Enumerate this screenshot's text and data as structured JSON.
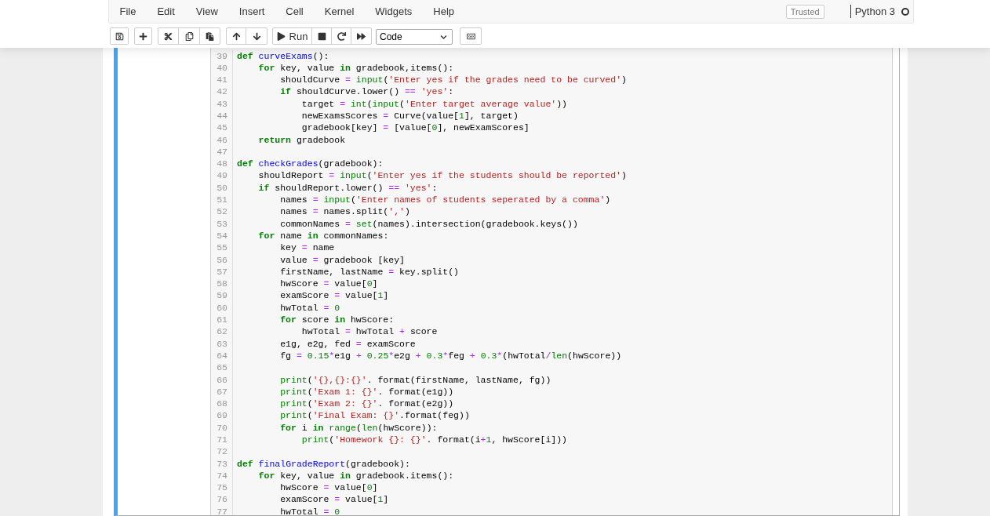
{
  "menu": [
    "File",
    "Edit",
    "View",
    "Insert",
    "Cell",
    "Kernel",
    "Widgets",
    "Help"
  ],
  "trust_indicator": "Trusted",
  "kernel": {
    "name": "Python 3",
    "busy": false
  },
  "toolbar": {
    "run_label": "Run",
    "cell_type": "Code"
  },
  "cell": {
    "selected": true,
    "lines": [
      {
        "number": "39",
        "tokens": [
          {
            "kind": "keyword",
            "text": "def"
          },
          {
            "kind": "name",
            "text": " curveExams"
          },
          {
            "kind": "plain",
            "text": "():"
          }
        ]
      },
      {
        "number": "40",
        "tokens": [
          {
            "kind": "keyword",
            "text": "    for"
          },
          {
            "kind": "plain",
            "text": " key, value "
          },
          {
            "kind": "keyword",
            "text": "in"
          },
          {
            "kind": "plain",
            "text": " gradebook,items():"
          }
        ]
      },
      {
        "number": "41",
        "tokens": [
          {
            "kind": "plain",
            "text": "        shouldCurve "
          },
          {
            "kind": "operator",
            "text": "="
          },
          {
            "kind": "builtin",
            "text": " input"
          },
          {
            "kind": "plain",
            "text": "("
          },
          {
            "kind": "string",
            "text": "'Enter yes if the grades need to be curved'"
          },
          {
            "kind": "plain",
            "text": ")"
          }
        ]
      },
      {
        "number": "42",
        "tokens": [
          {
            "kind": "keyword",
            "text": "        if"
          },
          {
            "kind": "plain",
            "text": " shouldCurve.lower() "
          },
          {
            "kind": "operator",
            "text": "=="
          },
          {
            "kind": "string",
            "text": " 'yes'"
          },
          {
            "kind": "plain",
            "text": ":"
          }
        ]
      },
      {
        "number": "43",
        "tokens": [
          {
            "kind": "plain",
            "text": "            target "
          },
          {
            "kind": "operator",
            "text": "="
          },
          {
            "kind": "builtin",
            "text": " int"
          },
          {
            "kind": "plain",
            "text": "("
          },
          {
            "kind": "builtin",
            "text": "input"
          },
          {
            "kind": "plain",
            "text": "("
          },
          {
            "kind": "string",
            "text": "'Enter target average value'"
          },
          {
            "kind": "plain",
            "text": "))"
          }
        ]
      },
      {
        "number": "44",
        "tokens": [
          {
            "kind": "plain",
            "text": "            newExamsScores "
          },
          {
            "kind": "operator",
            "text": "="
          },
          {
            "kind": "plain",
            "text": " Curve(value["
          },
          {
            "kind": "number",
            "text": "1"
          },
          {
            "kind": "plain",
            "text": "], target)"
          }
        ]
      },
      {
        "number": "45",
        "tokens": [
          {
            "kind": "plain",
            "text": "            gradebook[key] "
          },
          {
            "kind": "operator",
            "text": "="
          },
          {
            "kind": "plain",
            "text": " [value["
          },
          {
            "kind": "number",
            "text": "0"
          },
          {
            "kind": "plain",
            "text": "], newExamScores]"
          }
        ]
      },
      {
        "number": "46",
        "tokens": [
          {
            "kind": "keyword",
            "text": "    return"
          },
          {
            "kind": "plain",
            "text": " gradebook"
          }
        ]
      },
      {
        "number": "47"
      },
      {
        "number": "48",
        "tokens": [
          {
            "kind": "keyword",
            "text": "def"
          },
          {
            "kind": "name",
            "text": " checkGrades"
          },
          {
            "kind": "plain",
            "text": "(gradebook):"
          }
        ]
      },
      {
        "number": "49",
        "tokens": [
          {
            "kind": "plain",
            "text": "    shouldReport "
          },
          {
            "kind": "operator",
            "text": "="
          },
          {
            "kind": "builtin",
            "text": " input"
          },
          {
            "kind": "plain",
            "text": "("
          },
          {
            "kind": "string",
            "text": "'Enter yes if the students should be reported'"
          },
          {
            "kind": "plain",
            "text": ")"
          }
        ]
      },
      {
        "number": "50",
        "tokens": [
          {
            "kind": "keyword",
            "text": "    if"
          },
          {
            "kind": "plain",
            "text": " shouldReport.lower() "
          },
          {
            "kind": "operator",
            "text": "=="
          },
          {
            "kind": "string",
            "text": " 'yes'"
          },
          {
            "kind": "plain",
            "text": ":"
          }
        ]
      },
      {
        "number": "51",
        "tokens": [
          {
            "kind": "plain",
            "text": "        names "
          },
          {
            "kind": "operator",
            "text": "="
          },
          {
            "kind": "builtin",
            "text": " input"
          },
          {
            "kind": "plain",
            "text": "("
          },
          {
            "kind": "string",
            "text": "'Enter names of students seperated by a comma'"
          },
          {
            "kind": "plain",
            "text": ")"
          }
        ]
      },
      {
        "number": "52",
        "tokens": [
          {
            "kind": "plain",
            "text": "        names "
          },
          {
            "kind": "operator",
            "text": "="
          },
          {
            "kind": "plain",
            "text": " names.split("
          },
          {
            "kind": "string",
            "text": "','"
          },
          {
            "kind": "plain",
            "text": ")"
          }
        ]
      },
      {
        "number": "53",
        "tokens": [
          {
            "kind": "plain",
            "text": "        commonNames "
          },
          {
            "kind": "operator",
            "text": "="
          },
          {
            "kind": "builtin",
            "text": " set"
          },
          {
            "kind": "plain",
            "text": "(names).intersection(gradebook.keys())"
          }
        ]
      },
      {
        "number": "54",
        "tokens": [
          {
            "kind": "keyword",
            "text": "    for"
          },
          {
            "kind": "plain",
            "text": " name "
          },
          {
            "kind": "keyword",
            "text": "in"
          },
          {
            "kind": "plain",
            "text": " commonNames:"
          }
        ]
      },
      {
        "number": "55",
        "tokens": [
          {
            "kind": "plain",
            "text": "        key "
          },
          {
            "kind": "operator",
            "text": "="
          },
          {
            "kind": "plain",
            "text": " name"
          }
        ]
      },
      {
        "number": "56",
        "tokens": [
          {
            "kind": "plain",
            "text": "        value "
          },
          {
            "kind": "operator",
            "text": "="
          },
          {
            "kind": "plain",
            "text": " gradebook [key]"
          }
        ]
      },
      {
        "number": "57",
        "tokens": [
          {
            "kind": "plain",
            "text": "        firstName, lastName "
          },
          {
            "kind": "operator",
            "text": "="
          },
          {
            "kind": "plain",
            "text": " key.split()"
          }
        ]
      },
      {
        "number": "58",
        "tokens": [
          {
            "kind": "plain",
            "text": "        hwScore "
          },
          {
            "kind": "operator",
            "text": "="
          },
          {
            "kind": "plain",
            "text": " value["
          },
          {
            "kind": "number",
            "text": "0"
          },
          {
            "kind": "plain",
            "text": "]"
          }
        ]
      },
      {
        "number": "59",
        "tokens": [
          {
            "kind": "plain",
            "text": "        examScore "
          },
          {
            "kind": "operator",
            "text": "="
          },
          {
            "kind": "plain",
            "text": " value["
          },
          {
            "kind": "number",
            "text": "1"
          },
          {
            "kind": "plain",
            "text": "]"
          }
        ]
      },
      {
        "number": "60",
        "tokens": [
          {
            "kind": "plain",
            "text": "        hwTotal "
          },
          {
            "kind": "operator",
            "text": "="
          },
          {
            "kind": "number",
            "text": " 0"
          }
        ]
      },
      {
        "number": "61",
        "tokens": [
          {
            "kind": "keyword",
            "text": "        for"
          },
          {
            "kind": "plain",
            "text": " score "
          },
          {
            "kind": "keyword",
            "text": "in"
          },
          {
            "kind": "plain",
            "text": " hwScore:"
          }
        ]
      },
      {
        "number": "62",
        "tokens": [
          {
            "kind": "plain",
            "text": "            hwTotal "
          },
          {
            "kind": "operator",
            "text": "="
          },
          {
            "kind": "plain",
            "text": " hwTotal "
          },
          {
            "kind": "operator",
            "text": "+"
          },
          {
            "kind": "plain",
            "text": " score"
          }
        ]
      },
      {
        "number": "63",
        "tokens": [
          {
            "kind": "plain",
            "text": "        e1g, e2g, fed "
          },
          {
            "kind": "operator",
            "text": "="
          },
          {
            "kind": "plain",
            "text": " examScore"
          }
        ]
      },
      {
        "number": "64",
        "tokens": [
          {
            "kind": "plain",
            "text": "        fg "
          },
          {
            "kind": "operator",
            "text": "="
          },
          {
            "kind": "number",
            "text": " 0.15"
          },
          {
            "kind": "operator",
            "text": "*"
          },
          {
            "kind": "plain",
            "text": "e1g "
          },
          {
            "kind": "operator",
            "text": "+"
          },
          {
            "kind": "number",
            "text": " 0.25"
          },
          {
            "kind": "operator",
            "text": "*"
          },
          {
            "kind": "plain",
            "text": "e2g "
          },
          {
            "kind": "operator",
            "text": "+"
          },
          {
            "kind": "number",
            "text": " 0.3"
          },
          {
            "kind": "operator",
            "text": "*"
          },
          {
            "kind": "plain",
            "text": "feg "
          },
          {
            "kind": "operator",
            "text": "+"
          },
          {
            "kind": "number",
            "text": " 0.3"
          },
          {
            "kind": "operator",
            "text": "*"
          },
          {
            "kind": "plain",
            "text": "(hwTotal"
          },
          {
            "kind": "operator",
            "text": "/"
          },
          {
            "kind": "builtin",
            "text": "len"
          },
          {
            "kind": "plain",
            "text": "(hwScore))"
          }
        ]
      },
      {
        "number": "65"
      },
      {
        "number": "66",
        "tokens": [
          {
            "kind": "builtin",
            "text": "        print"
          },
          {
            "kind": "plain",
            "text": "("
          },
          {
            "kind": "string",
            "text": "'{},{}:{}'"
          },
          {
            "kind": "plain",
            "text": ". format(firstName, lastName, fg))"
          }
        ]
      },
      {
        "number": "67",
        "tokens": [
          {
            "kind": "builtin",
            "text": "        print"
          },
          {
            "kind": "plain",
            "text": "("
          },
          {
            "kind": "string",
            "text": "'Exam 1: {}'"
          },
          {
            "kind": "plain",
            "text": ". format(e1g))"
          }
        ]
      },
      {
        "number": "68",
        "tokens": [
          {
            "kind": "builtin",
            "text": "        print"
          },
          {
            "kind": "plain",
            "text": "("
          },
          {
            "kind": "string",
            "text": "'Exam 2: {}'"
          },
          {
            "kind": "plain",
            "text": ". format(e2g))"
          }
        ]
      },
      {
        "number": "69",
        "tokens": [
          {
            "kind": "builtin",
            "text": "        print"
          },
          {
            "kind": "plain",
            "text": "("
          },
          {
            "kind": "string",
            "text": "'Final Exam: {}'"
          },
          {
            "kind": "plain",
            "text": ".format(feg))"
          }
        ]
      },
      {
        "number": "70",
        "tokens": [
          {
            "kind": "keyword",
            "text": "        for"
          },
          {
            "kind": "plain",
            "text": " i "
          },
          {
            "kind": "keyword",
            "text": "in"
          },
          {
            "kind": "builtin",
            "text": " range"
          },
          {
            "kind": "plain",
            "text": "("
          },
          {
            "kind": "builtin",
            "text": "len"
          },
          {
            "kind": "plain",
            "text": "(hwScore)):"
          }
        ]
      },
      {
        "number": "71",
        "tokens": [
          {
            "kind": "builtin",
            "text": "            print"
          },
          {
            "kind": "plain",
            "text": "("
          },
          {
            "kind": "string",
            "text": "'Homework {}: {}'"
          },
          {
            "kind": "plain",
            "text": ". format(i"
          },
          {
            "kind": "operator",
            "text": "+"
          },
          {
            "kind": "number",
            "text": "1"
          },
          {
            "kind": "plain",
            "text": ", hwScore[i]))"
          }
        ]
      },
      {
        "number": "72"
      },
      {
        "number": "73",
        "tokens": [
          {
            "kind": "keyword",
            "text": "def"
          },
          {
            "kind": "name",
            "text": " finalGradeReport"
          },
          {
            "kind": "plain",
            "text": "(gradebook):"
          }
        ]
      },
      {
        "number": "74",
        "tokens": [
          {
            "kind": "keyword",
            "text": "    for"
          },
          {
            "kind": "plain",
            "text": " key, value "
          },
          {
            "kind": "keyword",
            "text": "in"
          },
          {
            "kind": "plain",
            "text": " gradebook.items():"
          }
        ]
      },
      {
        "number": "75",
        "tokens": [
          {
            "kind": "plain",
            "text": "        hwScore "
          },
          {
            "kind": "operator",
            "text": "="
          },
          {
            "kind": "plain",
            "text": " value["
          },
          {
            "kind": "number",
            "text": "0"
          },
          {
            "kind": "plain",
            "text": "]"
          }
        ]
      },
      {
        "number": "76",
        "tokens": [
          {
            "kind": "plain",
            "text": "        examScore "
          },
          {
            "kind": "operator",
            "text": "="
          },
          {
            "kind": "plain",
            "text": " value["
          },
          {
            "kind": "number",
            "text": "1"
          },
          {
            "kind": "plain",
            "text": "]"
          }
        ]
      },
      {
        "number": "77",
        "tokens": [
          {
            "kind": "plain",
            "text": "        hwTotal "
          },
          {
            "kind": "operator",
            "text": "="
          },
          {
            "kind": "number",
            "text": " 0"
          }
        ]
      }
    ]
  }
}
